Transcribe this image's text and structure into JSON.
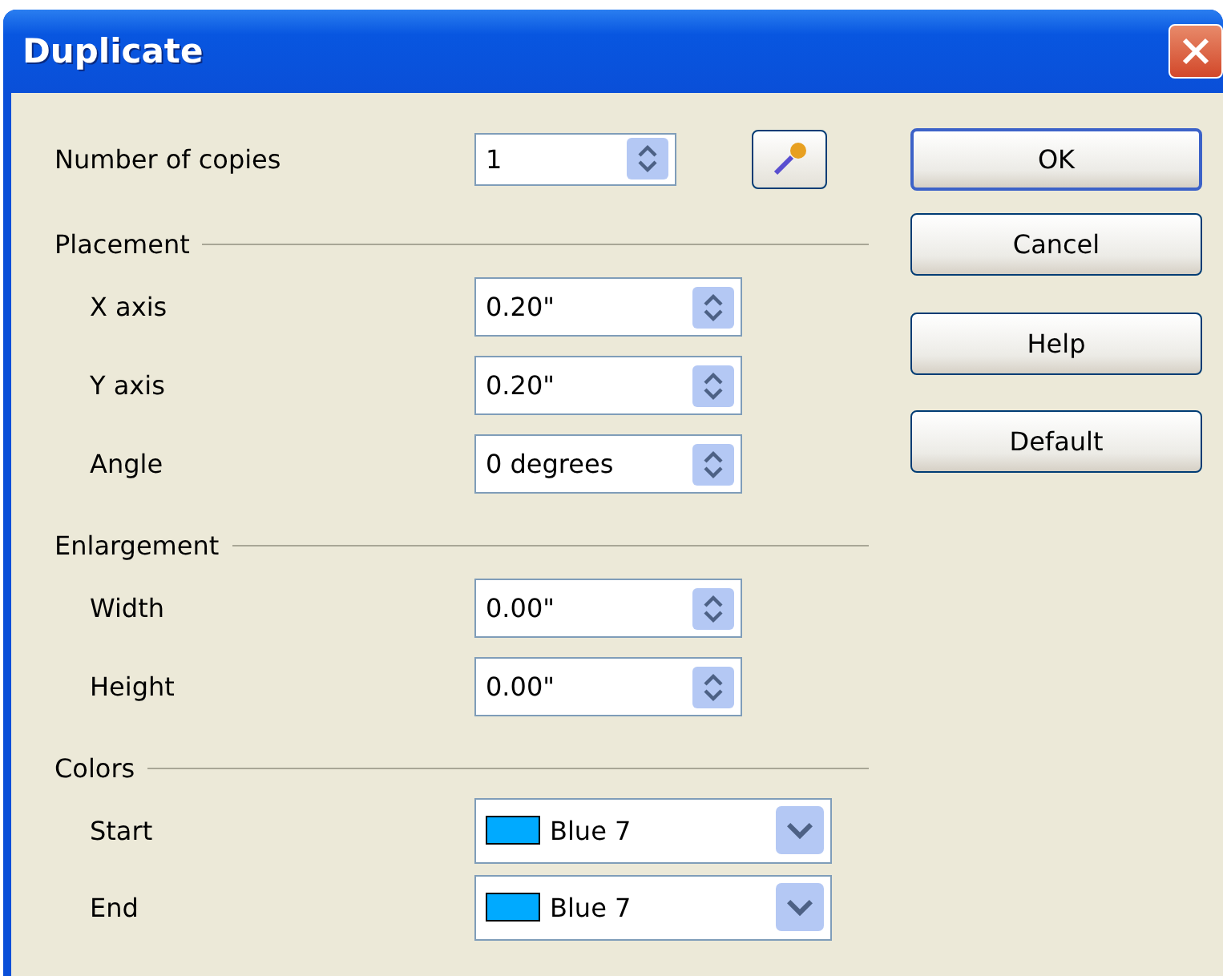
{
  "window": {
    "title": "Duplicate"
  },
  "copies": {
    "label": "Number of copies",
    "value": "1"
  },
  "sections": [
    {
      "title": "Placement",
      "fields": [
        {
          "kind": "spin",
          "label": "X axis",
          "value": "0.20\""
        },
        {
          "kind": "spin",
          "label": "Y axis",
          "value": "0.20\""
        },
        {
          "kind": "spin",
          "label": "Angle",
          "value": "0 degrees"
        }
      ]
    },
    {
      "title": "Enlargement",
      "fields": [
        {
          "kind": "spin",
          "label": "Width",
          "value": "0.00\""
        },
        {
          "kind": "spin",
          "label": "Height",
          "value": "0.00\""
        }
      ]
    },
    {
      "title": "Colors",
      "fields": [
        {
          "kind": "color",
          "label": "Start",
          "value": "Blue 7",
          "color": "#00aaff"
        },
        {
          "kind": "color",
          "label": "End",
          "value": "Blue 7",
          "color": "#00aaff"
        }
      ]
    }
  ],
  "buttons": [
    {
      "label": "OK",
      "default": true
    },
    {
      "label": "Cancel",
      "default": false
    },
    {
      "label": "Help",
      "default": false
    },
    {
      "label": "Default",
      "default": false
    }
  ]
}
